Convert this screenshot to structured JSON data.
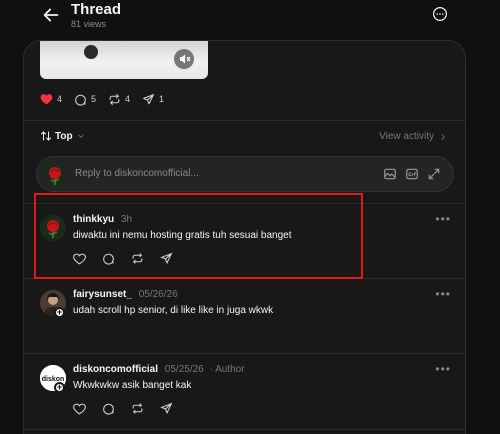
{
  "header": {
    "title": "Thread",
    "views": "81 views"
  },
  "post_stats": {
    "likes": "4",
    "comments": "5",
    "reposts": "4",
    "shares": "1",
    "like_color": "#ff3040"
  },
  "sort": {
    "label": "Top",
    "view_activity": "View activity"
  },
  "reply_box": {
    "placeholder": "Reply to diskoncomofficial..."
  },
  "replies": [
    {
      "username": "thinkkyu",
      "time": "3h",
      "text": "diwaktu ini nemu hosting gratis tuh sesuai banget",
      "avatar": "rose-avatar",
      "highlighted": true
    },
    {
      "username": "fairysunset_",
      "time": "05/26/26",
      "text": "udah scroll hp senior, di like like in juga wkwk",
      "avatar": "portrait-avatar"
    },
    {
      "username": "diskoncomofficial",
      "time": "05/25/26",
      "author_label": "· Author",
      "text": "Wkwkwkw asik banget kak",
      "avatar": "diskon-logo-avatar",
      "logo_text": "diskon"
    }
  ],
  "colors": {
    "background": "#101010",
    "panel": "#181818",
    "highlight": "#e01a1a"
  }
}
